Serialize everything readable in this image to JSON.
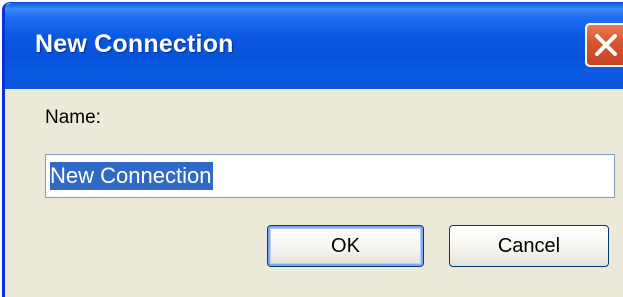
{
  "dialog": {
    "title": "New Connection",
    "name_label": "Name:",
    "name_value": "New Connection",
    "ok_label": "OK",
    "cancel_label": "Cancel"
  },
  "icons": {
    "close": "close-icon"
  },
  "colors": {
    "title_bar": "#0a58e0",
    "close_button": "#d8542f",
    "dialog_background": "#ece9d8",
    "selection": "#316ac5"
  }
}
